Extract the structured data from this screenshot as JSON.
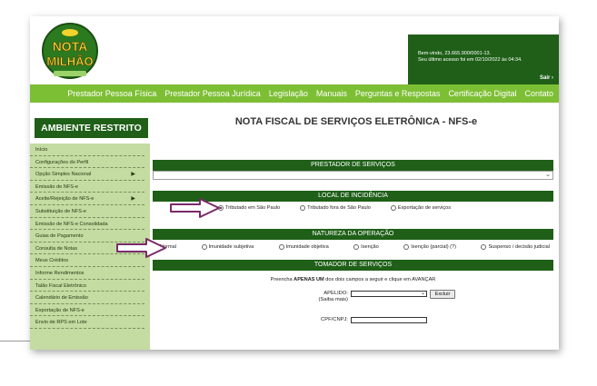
{
  "header": {
    "logo_text": [
      "NOTA",
      "MILHÃO"
    ],
    "welcome_line1": "Bem-vindo, 23.665.900/0001-13.",
    "welcome_line2": "Seu último acesso foi em 02/10/2022 às 04:34.",
    "logout": "Sair"
  },
  "nav": {
    "items": [
      "Prestador Pessoa Física",
      "Prestador Pessoa Jurídica",
      "Legislação",
      "Manuais",
      "Perguntas e Respostas",
      "Certificação Digital",
      "Contato"
    ]
  },
  "sidebar": {
    "title": "AMBIENTE RESTRITO",
    "items": [
      {
        "label": "Início",
        "submenu": false
      },
      {
        "label": "Configurações do Perfil",
        "submenu": false
      },
      {
        "label": "Opção Simples Nacional",
        "submenu": true
      },
      {
        "label": "Emissão de NFS-e",
        "submenu": false
      },
      {
        "label": "Aceite/Rejeição de NFS-e",
        "submenu": true
      },
      {
        "label": "Substituição de NFS-e",
        "submenu": false
      },
      {
        "label": "Emissão de NFS-e Consolidada",
        "submenu": false
      },
      {
        "label": "Guias de Pagamento",
        "submenu": false
      },
      {
        "label": "Consulta de Notas",
        "submenu": false
      },
      {
        "label": "Meus Créditos",
        "submenu": false
      },
      {
        "label": "Informe Rendimentos",
        "submenu": false
      },
      {
        "label": "Talão Fiscal Eletrônico",
        "submenu": false
      },
      {
        "label": "Calendário de Emissão",
        "submenu": false
      },
      {
        "label": "Exportação de NFS-e",
        "submenu": false
      },
      {
        "label": "Envio de RPS em Lote",
        "submenu": false
      }
    ]
  },
  "main": {
    "title": "NOTA FISCAL DE SERVIÇOS ELETRÔNICA - NFS-e",
    "prestador_header": "PRESTADOR DE SERVIÇOS",
    "local_header": "LOCAL DE INCIDÊNCIA",
    "local_options": [
      "Tributado em São Paulo",
      "Tributado fora de São Paulo",
      "Exportação de serviços"
    ],
    "local_selected": 0,
    "natureza_header": "NATUREZA DA OPERAÇÃO",
    "natureza_options": [
      "Normal",
      "Imunidade subjetiva",
      "Imunidade objetiva",
      "Isenção",
      "Isenção (parcial) (?)",
      "Suspenso / decisão judicial"
    ],
    "natureza_selected": 0,
    "tomador_header": "TOMADOR DE SERVIÇOS",
    "hint_prefix": "Preencha ",
    "hint_bold": "APENAS UM",
    "hint_suffix": " dos dois campos a seguir e clique em AVANÇAR",
    "apelido_label": "APELIDO:",
    "apelido_sub": "(Saiba mais)",
    "apelido_value": "",
    "excluir_button": "Excluir",
    "cpf_label": "CPF/CNPJ:",
    "cpf_value": ""
  },
  "colors": {
    "dark_green": "#1f5f18",
    "nav_green": "#7dbf34",
    "sidebar_bg": "#c4dba2",
    "arrow": "#7a2a6a"
  },
  "icons": [
    "pointer-arrow-icon",
    "chevron-down-icon",
    "chevron-right-icon"
  ]
}
